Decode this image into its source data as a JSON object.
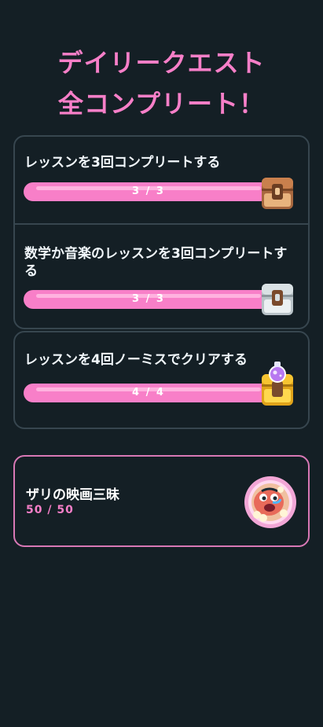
{
  "header": {
    "title_line1": "デイリークエスト",
    "title_line2": "全コンプリート！"
  },
  "quests": [
    {
      "title": "レッスンを3回コンプリートする",
      "progress_label": "3 / 3",
      "progress": 1.0,
      "reward_icon": "wooden-chest-icon"
    },
    {
      "title": "数学か音楽のレッスンを3回コンプリートする",
      "progress_label": "3 / 3",
      "progress": 1.0,
      "reward_icon": "silver-chest-icon"
    },
    {
      "title": "レッスンを4回ノーミスでクリアする",
      "progress_label": "4 / 4",
      "progress": 1.0,
      "reward_icon": "gold-chest-potion-icon"
    }
  ],
  "milestone": {
    "title": "ザリの映画三昧",
    "progress_label": "50 / 50",
    "badge_icon": "zari-movie-badge-icon"
  },
  "colors": {
    "background": "#141f25",
    "accent_pink": "#f77fc8",
    "border": "#37464f",
    "milestone_border": "#d878b5"
  }
}
